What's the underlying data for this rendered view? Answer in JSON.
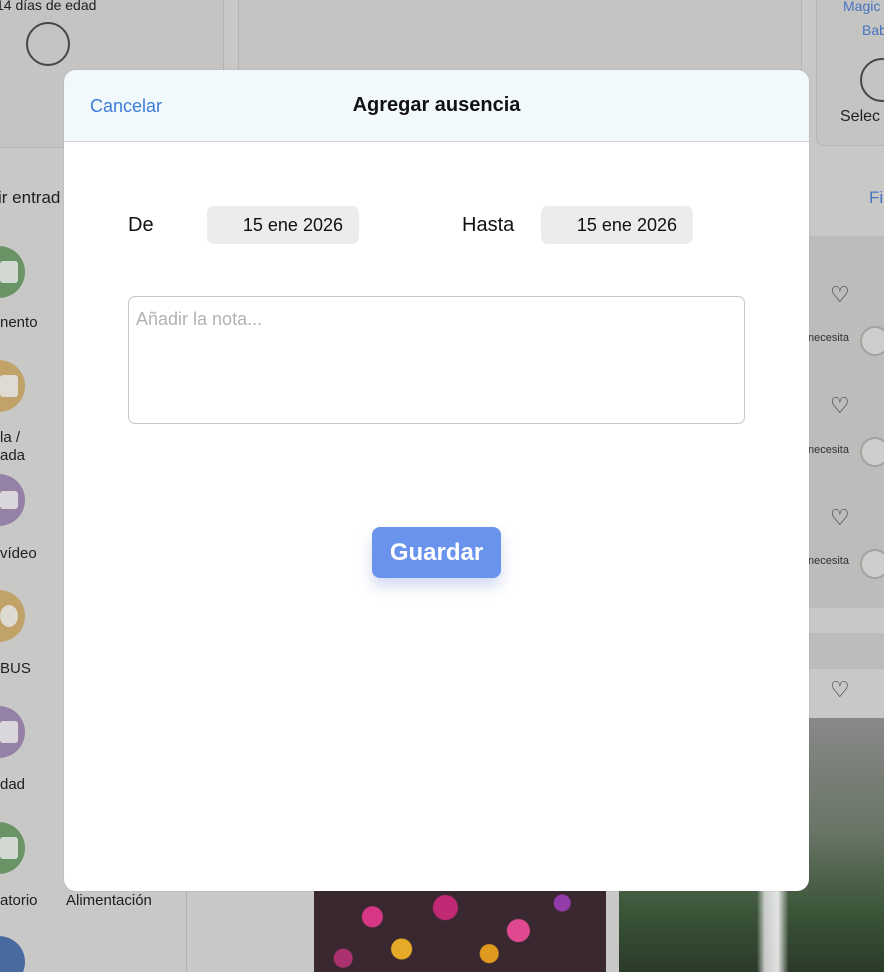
{
  "background": {
    "child_age": "14 días de edad",
    "top_right_name_1": "Magic",
    "top_right_name_2": "Bab",
    "top_right_select": "Selec",
    "add_entry": "ir entrad",
    "filter": "Fi",
    "side_items": [
      {
        "label": "nento",
        "color": "#6f9b6a"
      },
      {
        "label": "da /\nada",
        "color": "#c9a96e"
      },
      {
        "label": "vídeo",
        "color": "#9c86ad"
      },
      {
        "label": "BUS",
        "color": "#c9a96e"
      },
      {
        "label": "dad",
        "color": "#9c86ad"
      },
      {
        "label": "atorio",
        "color": "#6f9b6a"
      }
    ],
    "bottom_label": "Alimentación",
    "needs_label": "necesita"
  },
  "modal": {
    "cancel_label": "Cancelar",
    "title": "Agregar ausencia",
    "from_label": "De",
    "from_value": "15 ene 2026",
    "to_label": "Hasta",
    "to_value": "15 ene 2026",
    "note_placeholder": "Añadir la nota...",
    "note_value": "",
    "save_label": "Guardar"
  },
  "colors": {
    "accent": "#3d7bd8",
    "save_button": "#6a93ee",
    "header_bg": "#f2f9fd"
  }
}
